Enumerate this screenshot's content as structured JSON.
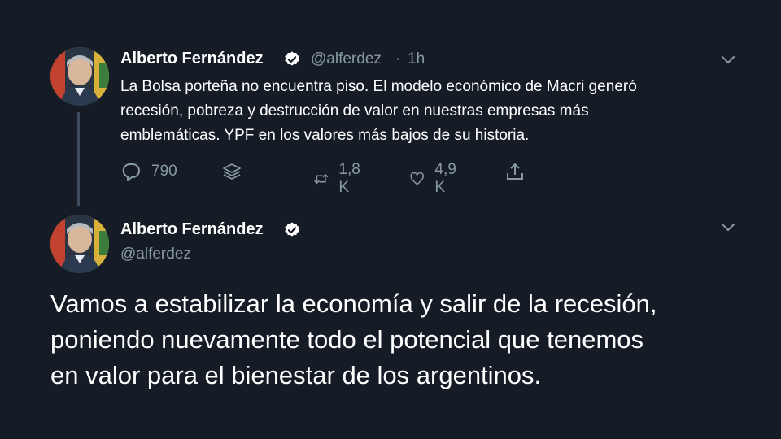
{
  "colors": {
    "background": "#151c26",
    "text_primary": "#ffffff",
    "text_secondary": "#8899a6",
    "verified_badge": "#ffffff",
    "thread_line": "#3d4b5c"
  },
  "tweet_1": {
    "display_name": "Alberto Fernández",
    "handle": "@alferdez",
    "separator": "·",
    "time": "1h",
    "text_lines": [
      "La Bolsa porteña no encuentra piso. El modelo económico de Macri generó",
      "recesión, pobreza y destrucción de valor en nuestras empresas más",
      "emblemáticas. YPF en los valores más bajos de su historia."
    ],
    "actions": {
      "reply_count": "790",
      "retweet_count": "1,8 K",
      "like_count": "4,9 K"
    },
    "icons": [
      "reply-icon",
      "layers-icon",
      "retweet-icon",
      "like-icon",
      "share-icon",
      "chevron-down-icon",
      "verified-icon"
    ]
  },
  "tweet_2": {
    "display_name": "Alberto Fernández",
    "handle": "@alferdez",
    "text_lines": [
      "Vamos a estabilizar la economía y salir de la recesión,",
      "poniendo nuevamente todo el potencial que tenemos",
      "en valor para el bienestar de los argentinos."
    ],
    "icons": [
      "chevron-down-icon",
      "verified-icon"
    ]
  }
}
